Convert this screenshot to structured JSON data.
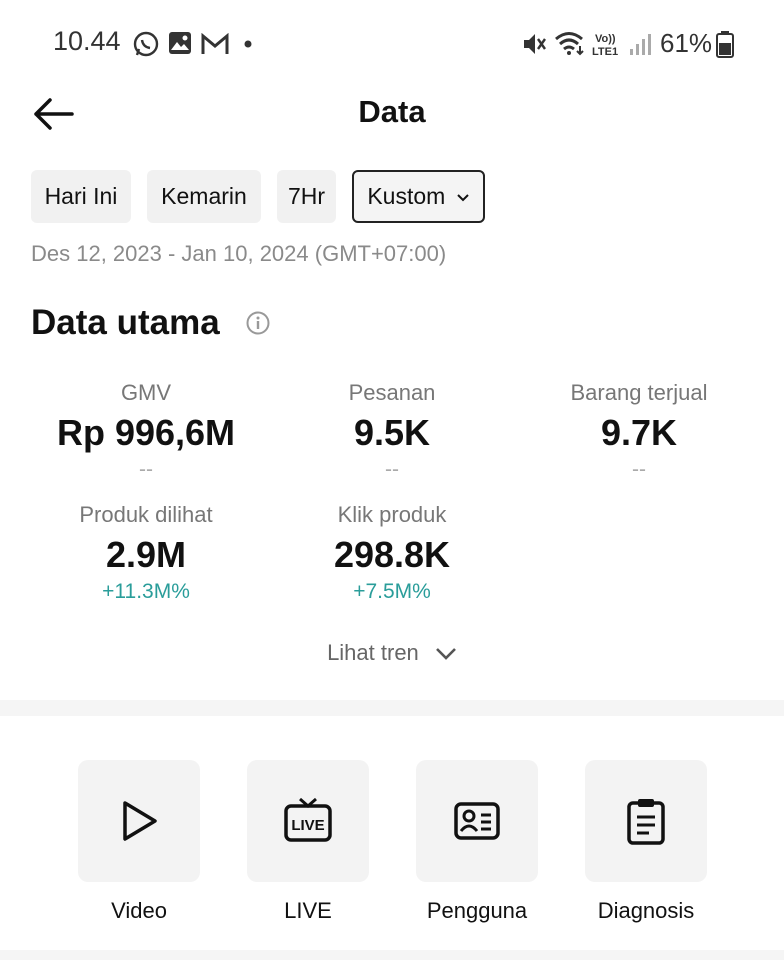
{
  "status_bar": {
    "time": "10.44",
    "battery": "61%"
  },
  "header": {
    "title": "Data"
  },
  "filters": {
    "today": "Hari Ini",
    "yesterday": "Kemarin",
    "week": "7Hr",
    "custom": "Kustom"
  },
  "date_range": "Des 12, 2023 - Jan 10, 2024 (GMT+07:00)",
  "main": {
    "section_title": "Data utama",
    "metrics": [
      {
        "label": "GMV",
        "value": "Rp 996,6M",
        "change": "--"
      },
      {
        "label": "Pesanan",
        "value": "9.5K",
        "change": "--"
      },
      {
        "label": "Barang terjual",
        "value": "9.7K",
        "change": "--"
      },
      {
        "label": "Produk dilihat",
        "value": "2.9M",
        "change": "+11.3M%"
      },
      {
        "label": "Klik produk",
        "value": "298.8K",
        "change": "+7.5M%"
      }
    ],
    "see_trend": "Lihat tren"
  },
  "shortcuts": [
    {
      "label": "Video",
      "icon": "play-icon"
    },
    {
      "label": "LIVE",
      "icon": "live-tv-icon"
    },
    {
      "label": "Pengguna",
      "icon": "id-card-icon"
    },
    {
      "label": "Diagnosis",
      "icon": "clipboard-icon"
    }
  ],
  "colors": {
    "positive": "#2a9d9a",
    "accent": "#111111"
  }
}
